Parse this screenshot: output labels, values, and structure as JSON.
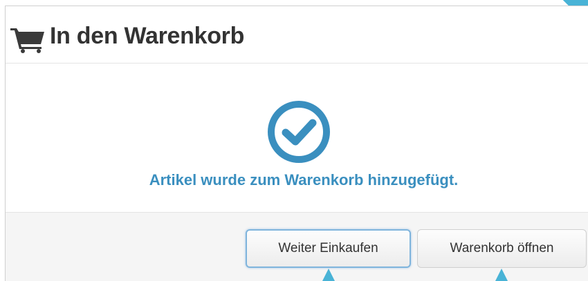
{
  "modal": {
    "title": "In den Warenkorb",
    "title_icon": "shopping-cart-icon",
    "success_icon": "check-circle-icon",
    "success_message": "Artikel wurde zum Warenkorb hinzugefügt.",
    "buttons": {
      "continue_label": "Weiter Einkaufen",
      "open_cart_label": "Warenkorb öffnen"
    }
  },
  "annotation": {
    "pointer_icon": "arrow-up-icon"
  },
  "colors": {
    "accent": "#3a8fbf",
    "title": "#333333",
    "annotation": "#49b3d6",
    "footer_bg": "#f5f5f5"
  }
}
